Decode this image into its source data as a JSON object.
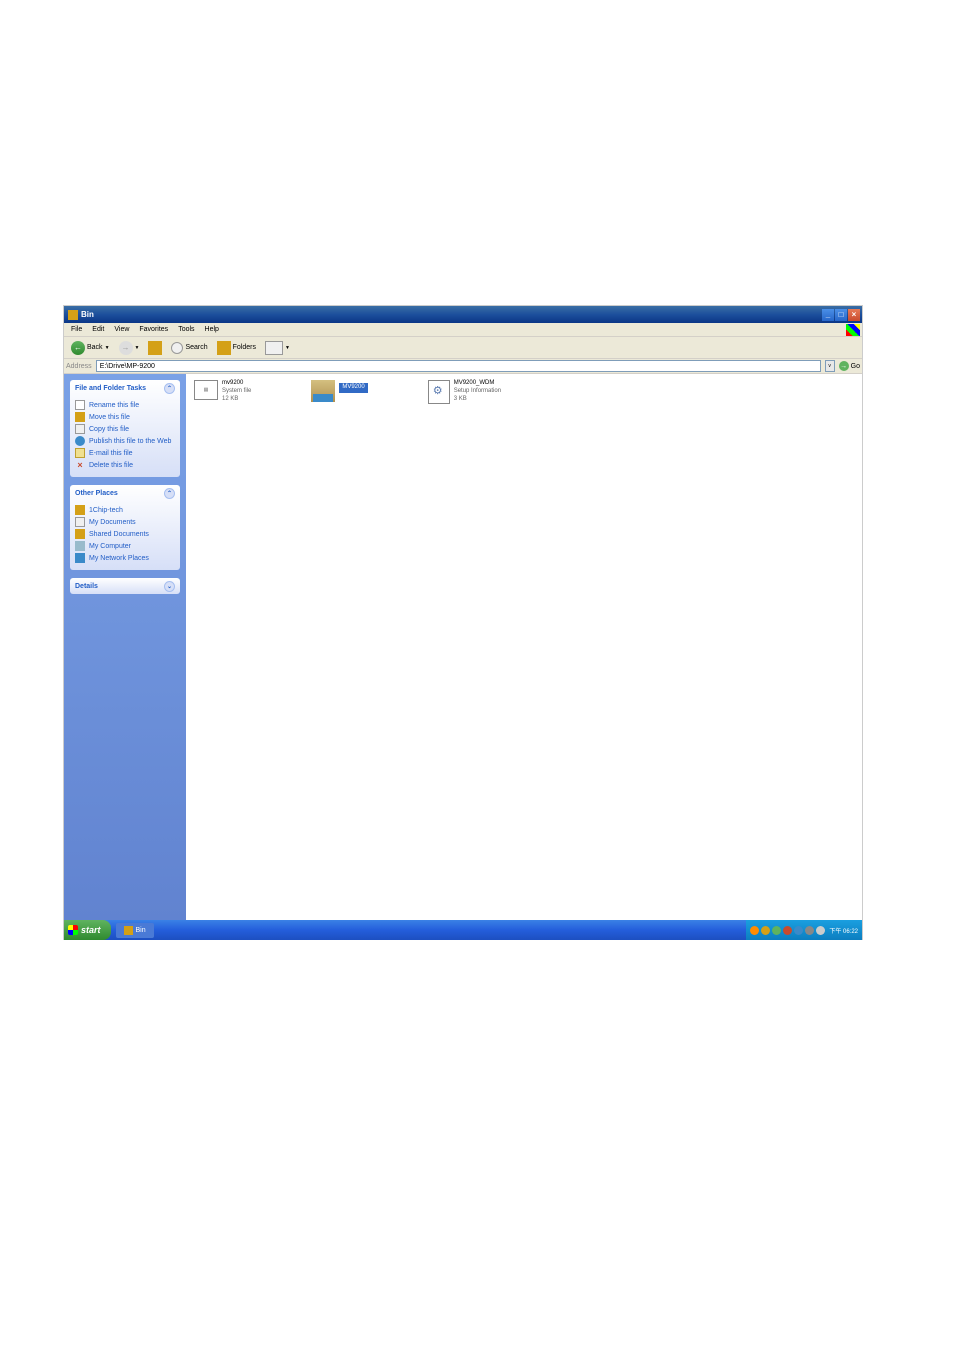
{
  "window": {
    "title": "Bin"
  },
  "menubar": {
    "file": "File",
    "edit": "Edit",
    "view": "View",
    "favorites": "Favorites",
    "tools": "Tools",
    "help": "Help"
  },
  "toolbar": {
    "back": "Back",
    "search": "Search",
    "folders": "Folders"
  },
  "addressbar": {
    "label": "Address",
    "value": "E:\\Drive\\MP-9200",
    "go": "Go"
  },
  "sidebar": {
    "file_tasks": {
      "title": "File and Folder Tasks",
      "rename": "Rename this file",
      "move": "Move this file",
      "copy": "Copy this file",
      "publish": "Publish this file to the Web",
      "email": "E-mail this file",
      "delete": "Delete this file"
    },
    "other_places": {
      "title": "Other Places",
      "item1": "1Chip-tech",
      "item2": "My Documents",
      "item3": "Shared Documents",
      "item4": "My Computer",
      "item5": "My Network Places"
    },
    "details": {
      "title": "Details"
    }
  },
  "files": {
    "file1": {
      "name": "mv9200",
      "type": "System file",
      "size": "12 KB"
    },
    "file2": {
      "selected_label": "MV9200"
    },
    "file3": {
      "name": "MV9200_WDM",
      "type": "Setup Information",
      "size": "3 KB"
    }
  },
  "taskbar": {
    "start": "start",
    "task1": "Bin",
    "clock": "下午 06:22"
  }
}
